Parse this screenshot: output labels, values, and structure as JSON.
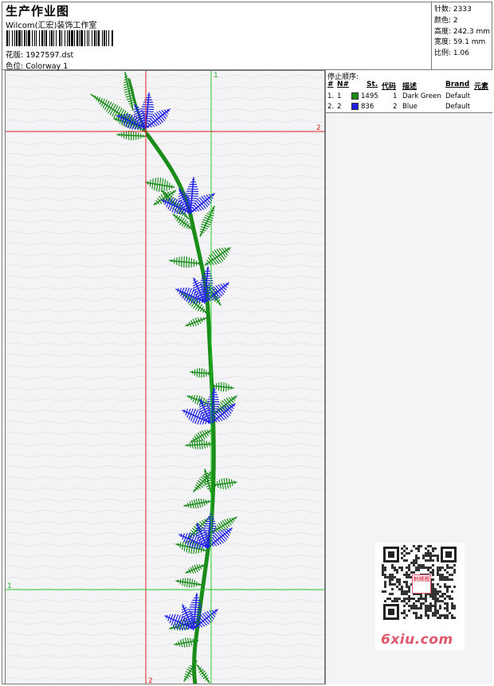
{
  "header": {
    "title": "生产作业图",
    "studio": "Wilcom(汇宏)装饰工作室",
    "design_label": "花版: 1927597.dst",
    "colorway_label": "色位: Colorway 1"
  },
  "stats": {
    "stitches": "针数: 2333",
    "colors": "颜色: 2",
    "height": "高度: 242.3 mm",
    "width": "宽度: 59.1 mm",
    "scale": "比例: 1.06"
  },
  "guides": {
    "v1_label": "1",
    "v2_label": "2",
    "h1_label": "1",
    "h2_label": "2"
  },
  "stop_sequence": {
    "title": "停止顺序:",
    "headers": [
      "#",
      "N#",
      "St.",
      "代码",
      "描述",
      "Brand",
      "元素"
    ],
    "rows": [
      {
        "index": "1.",
        "n": "1",
        "stitches": "1495",
        "code": "1",
        "desc": "Dark Green",
        "brand": "Default",
        "color": "#1a8c1a"
      },
      {
        "index": "2.",
        "n": "2",
        "stitches": "836",
        "code": "2",
        "desc": "Blue",
        "brand": "Default",
        "color": "#1f1fe6"
      }
    ]
  },
  "colors": {
    "green": "#1a8c1a",
    "blue": "#1f1fe6",
    "guide_red": "#e02020",
    "guide_green": "#22cc22",
    "watermark": "#e0566a"
  },
  "watermark": {
    "text": "6xiu.com",
    "seal": "刺绣图"
  }
}
